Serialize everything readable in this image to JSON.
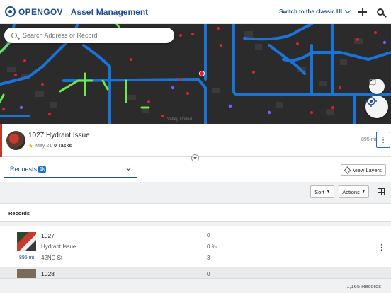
{
  "header": {
    "logo_text": "OPENGOV",
    "app_title": "Asset Management",
    "classic_link": "Switch to the classic UI"
  },
  "map": {
    "search_placeholder": "Search Address or Record",
    "label": "Valley United"
  },
  "selected_record": {
    "title": "1027 Hydrant Issue",
    "date": "May 21",
    "tasks": "0 Tasks",
    "distance": "895 mi"
  },
  "tabs": {
    "requests_label": "Requests",
    "requests_badge": "1k",
    "view_layers": "View Layers"
  },
  "toolbar": {
    "sort": "Sort",
    "actions": "Actions"
  },
  "records": {
    "title": "Records",
    "rows": [
      {
        "id": "1027",
        "type": "Hydrant Issue",
        "street": "42ND St",
        "distance": "895 mi",
        "col1": "0",
        "col2": "0 %",
        "col3": "3"
      },
      {
        "id": "1028",
        "col1": "0"
      }
    ],
    "count": "1,165 Records"
  },
  "colors": {
    "brand": "#1d4f91",
    "accent_blue": "#1d6fc4",
    "map_bg": "#2b2b2b",
    "road_blue": "#1a73d9",
    "road_green": "#6ee84a",
    "marker_red": "#e0202a",
    "marker_purple": "#7a5cff"
  },
  "icons": {
    "logo": "opengov-logo-icon",
    "add": "plus-icon",
    "search": "search-icon",
    "layers": "layers-icon",
    "locate": "locate-icon",
    "star": "star-icon",
    "more": "more-vertical-icon",
    "grid": "grid-icon"
  }
}
